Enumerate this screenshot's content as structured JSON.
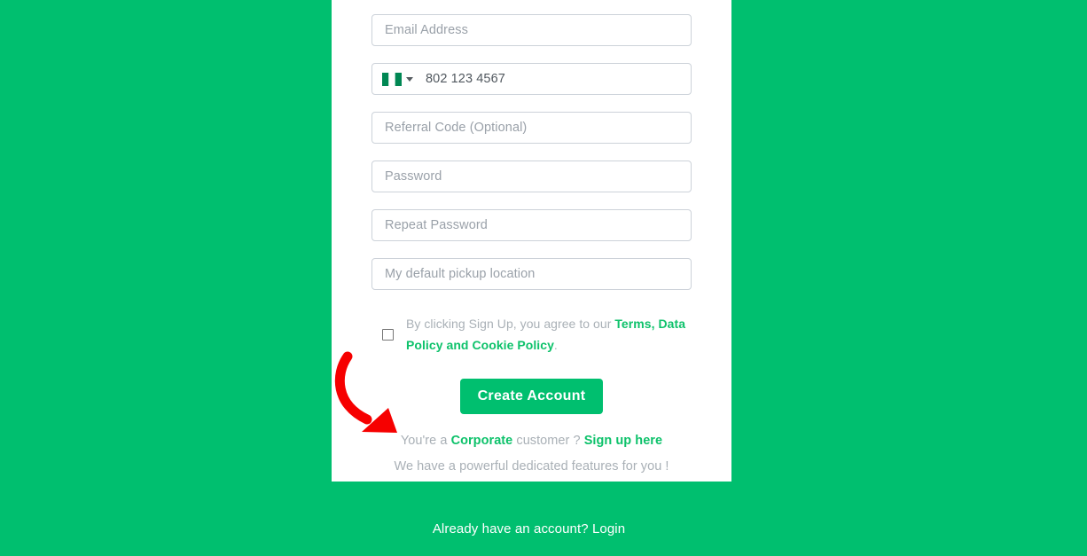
{
  "theme": {
    "brand_green": "#00bf6f",
    "link_green": "#0ec26b",
    "placeholder_gray": "#9aa1a9",
    "muted_gray": "#a9b0b6",
    "field_border": "#ccd2d9",
    "card_background": "#ffffff",
    "annotation_red": "#f60000"
  },
  "form": {
    "fields": [
      {
        "name": "email",
        "placeholder": "Email Address",
        "value": ""
      },
      {
        "name": "phone",
        "placeholder": "802 123 4567",
        "value": "802 123 4567"
      },
      {
        "name": "referral_code",
        "placeholder": "Referral Code (Optional)",
        "value": ""
      },
      {
        "name": "password",
        "placeholder": "Password",
        "value": ""
      },
      {
        "name": "repeat_password",
        "placeholder": "Repeat Password",
        "value": ""
      },
      {
        "name": "pickup_location",
        "placeholder": "My default pickup location",
        "value": ""
      }
    ],
    "phone": {
      "country_flag": "nigeria-flag-icon",
      "dropdown_icon": "chevron-down-icon",
      "number": "802 123 4567"
    },
    "terms": {
      "checkbox_checked": false,
      "prefix": "By clicking Sign Up, you agree to our ",
      "link_part_1": "Terms,",
      "link_part_2": "Data Policy and Cookie Policy",
      "suffix": "."
    },
    "submit_label": "Create Account"
  },
  "corporate": {
    "line1_prefix": "You're a ",
    "line1_highlight": "Corporate",
    "line1_middle": " customer ? ",
    "line1_link": "Sign up here",
    "line2": "We have a powerful dedicated features for you !"
  },
  "footer": {
    "text": "Already have an account? ",
    "login_label": "Login"
  },
  "annotation": {
    "type": "curved-arrow",
    "color": "#f60000",
    "points_to": "Sign up here"
  }
}
